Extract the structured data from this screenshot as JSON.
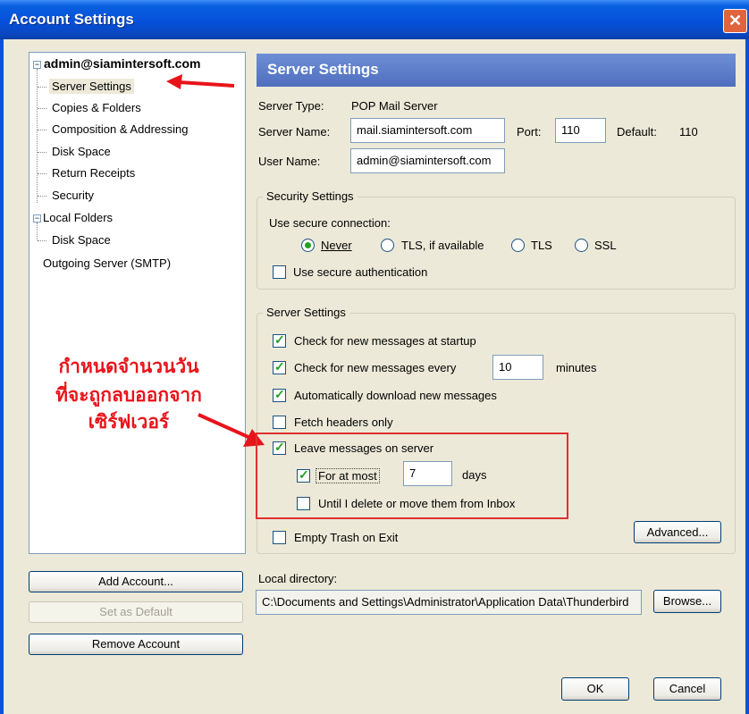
{
  "window": {
    "title": "Account Settings",
    "close_glyph": "✕"
  },
  "tree": {
    "account": "admin@siamintersoft.com",
    "account_children": [
      "Server Settings",
      "Copies & Folders",
      "Composition & Addressing",
      "Disk Space",
      "Return Receipts",
      "Security"
    ],
    "local_folders": "Local Folders",
    "local_children": [
      "Disk Space"
    ],
    "outgoing": "Outgoing Server (SMTP)",
    "expand_glyph": "−"
  },
  "annotation": {
    "line1": "กำหนดจำนวนวัน",
    "line2": "ที่จะถูกลบออกจาก",
    "line3": "เซิร์ฟเวอร์",
    "color": "#E8141B"
  },
  "buttons": {
    "add_account": "Add Account...",
    "set_default": "Set as Default",
    "remove_account": "Remove Account",
    "advanced": "Advanced...",
    "browse": "Browse...",
    "ok": "OK",
    "cancel": "Cancel"
  },
  "panel": {
    "header": "Server Settings",
    "server_type_label": "Server Type:",
    "server_type_value": "POP Mail Server",
    "server_name_label": "Server Name:",
    "server_name_value": "mail.siamintersoft.com",
    "port_label": "Port:",
    "port_value": "110",
    "default_label": "Default:",
    "default_value": "110",
    "user_name_label": "User Name:",
    "user_name_value": "admin@siamintersoft.com"
  },
  "security": {
    "group_title": "Security Settings",
    "use_secure_label": "Use secure connection:",
    "options": [
      "Never",
      "TLS, if available",
      "TLS",
      "SSL"
    ],
    "selected": "Never",
    "secure_auth_label": "Use secure authentication",
    "secure_auth_checked": false
  },
  "server_settings": {
    "group_title": "Server Settings",
    "check_startup": "Check for new messages at startup",
    "check_every": "Check for new messages every",
    "check_every_value": "10",
    "minutes": "minutes",
    "auto_download": "Automatically download new messages",
    "fetch_headers": "Fetch headers only",
    "leave_on_server": "Leave messages on server",
    "for_at_most": "For at most",
    "days_value": "7",
    "days": "days",
    "until_delete": "Until I delete or move them from Inbox",
    "empty_trash": "Empty Trash on Exit"
  },
  "local_directory": {
    "label": "Local directory:",
    "value": "C:\\Documents and Settings\\Administrator\\Application Data\\Thunderbird"
  },
  "colors": {
    "accent_header": "#5E7FC8",
    "title_bar": "#0550D8",
    "annotation": "#E8141B",
    "check": "#21A121"
  }
}
